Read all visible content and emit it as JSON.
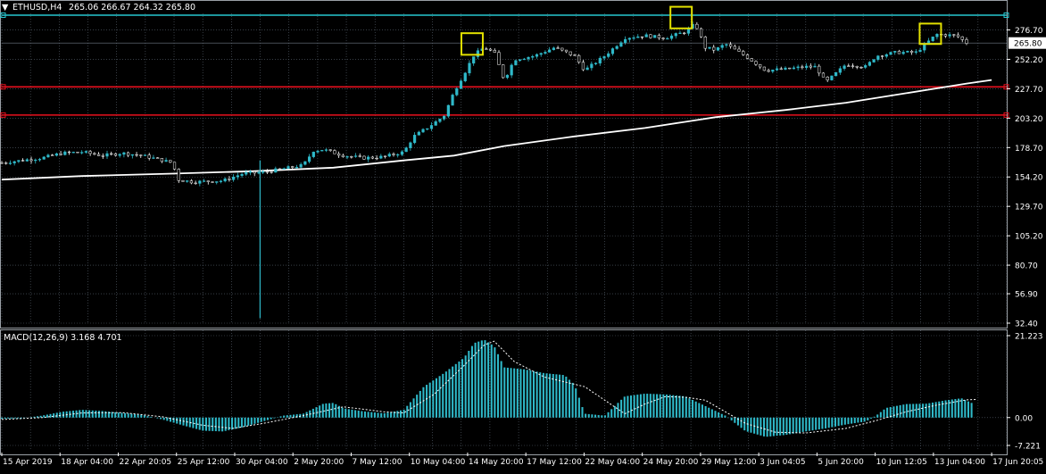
{
  "header": {
    "symbol": "ETHUSD,H4",
    "ohlc": "265.06 266.67 264.32 265.80"
  },
  "macd_label": "MACD(12,26,9) 3.168 4.701",
  "colors": {
    "background": "#000000",
    "grid": "#5a6470",
    "axis": "#ffffff",
    "bull": "#2fb9c9",
    "bear": "#ffffff",
    "ma": "#ffffff",
    "resistance": "#e8101e",
    "top_line": "#27c7d0",
    "highlight": "#e2e000",
    "macd_hist": "#2fb9c9",
    "macd_signal": "#ffffff"
  },
  "chart_data": [
    {
      "type": "candlestick",
      "title": "ETHUSD,H4",
      "y_ticks": [
        "276.70",
        "252.20",
        "227.70",
        "203.20",
        "178.70",
        "154.20",
        "129.70",
        "105.20",
        "80.70",
        "56.90",
        "32.40"
      ],
      "ylim": [
        32.4,
        289.0
      ],
      "current_price": "265.80",
      "x_ticks": [
        "15 Apr 2019",
        "18 Apr 04:00",
        "22 Apr 20:05",
        "25 Apr 12:00",
        "30 Apr 04:00",
        "2 May 20:00",
        "7 May 12:00",
        "10 May 04:00",
        "14 May 20:00",
        "17 May 12:00",
        "22 May 04:00",
        "24 May 20:00",
        "29 May 12:00",
        "3 Jun 04:05",
        "5 Jun 20:00",
        "10 Jun 12:05",
        "13 Jun 04:00",
        "17 Jun 20:05"
      ],
      "close_path": [
        [
          0,
          166
        ],
        [
          0.02,
          168
        ],
        [
          0.04,
          170
        ],
        [
          0.06,
          174
        ],
        [
          0.08,
          175
        ],
        [
          0.1,
          172
        ],
        [
          0.12,
          174
        ],
        [
          0.14,
          172
        ],
        [
          0.16,
          168
        ],
        [
          0.17,
          166
        ],
        [
          0.175,
          152
        ],
        [
          0.19,
          150
        ],
        [
          0.22,
          151
        ],
        [
          0.24,
          157
        ],
        [
          0.26,
          158
        ],
        [
          0.28,
          161
        ],
        [
          0.3,
          164
        ],
        [
          0.31,
          176
        ],
        [
          0.32,
          177
        ],
        [
          0.34,
          172
        ],
        [
          0.36,
          170
        ],
        [
          0.38,
          171
        ],
        [
          0.4,
          175
        ],
        [
          0.41,
          188
        ],
        [
          0.425,
          196
        ],
        [
          0.44,
          205
        ],
        [
          0.45,
          225
        ],
        [
          0.46,
          240
        ],
        [
          0.47,
          256
        ],
        [
          0.48,
          262
        ],
        [
          0.49,
          258
        ],
        [
          0.5,
          235
        ],
        [
          0.51,
          252
        ],
        [
          0.53,
          255
        ],
        [
          0.55,
          262
        ],
        [
          0.57,
          255
        ],
        [
          0.58,
          243
        ],
        [
          0.6,
          255
        ],
        [
          0.62,
          270
        ],
        [
          0.64,
          272
        ],
        [
          0.66,
          270
        ],
        [
          0.68,
          275
        ],
        [
          0.69,
          282
        ],
        [
          0.7,
          262
        ],
        [
          0.71,
          260
        ],
        [
          0.72,
          265
        ],
        [
          0.74,
          255
        ],
        [
          0.76,
          243
        ],
        [
          0.78,
          244
        ],
        [
          0.8,
          246
        ],
        [
          0.81,
          246
        ],
        [
          0.82,
          233
        ],
        [
          0.84,
          248
        ],
        [
          0.86,
          246
        ],
        [
          0.87,
          255
        ],
        [
          0.89,
          258
        ],
        [
          0.91,
          258
        ],
        [
          0.93,
          273
        ],
        [
          0.95,
          272
        ],
        [
          0.96,
          266
        ]
      ],
      "ma_path": [
        [
          0,
          152
        ],
        [
          0.08,
          155
        ],
        [
          0.17,
          157
        ],
        [
          0.25,
          159
        ],
        [
          0.33,
          162
        ],
        [
          0.4,
          168
        ],
        [
          0.45,
          172
        ],
        [
          0.5,
          180
        ],
        [
          0.57,
          188
        ],
        [
          0.64,
          195
        ],
        [
          0.71,
          204
        ],
        [
          0.78,
          210
        ],
        [
          0.84,
          216
        ],
        [
          0.9,
          224
        ],
        [
          0.96,
          232
        ],
        [
          0.985,
          235
        ]
      ],
      "horizontal_lines": [
        {
          "role": "top",
          "value": 289.0
        },
        {
          "role": "resistance-1",
          "value": 229.3
        },
        {
          "role": "resistance-2",
          "value": 205.8
        },
        {
          "role": "current",
          "value": 265.8
        }
      ],
      "spike": {
        "x": 0.257,
        "low": 36.5,
        "high": 168
      },
      "highlights": [
        {
          "x": 0.468,
          "low": 256,
          "high": 274
        },
        {
          "x": 0.676,
          "low": 278,
          "high": 296
        },
        {
          "x": 0.924,
          "low": 265,
          "high": 282
        }
      ]
    },
    {
      "type": "bar",
      "title": "MACD(12,26,9) 3.168 4.701",
      "y_ticks": [
        "21.223",
        "0.00",
        "-7.221"
      ],
      "ylim": [
        -7.221,
        21.223
      ],
      "histogram_path": [
        [
          0,
          -0.3
        ],
        [
          0.02,
          -0.2
        ],
        [
          0.04,
          0.5
        ],
        [
          0.06,
          1.5
        ],
        [
          0.08,
          2.0
        ],
        [
          0.1,
          1.7
        ],
        [
          0.12,
          1.2
        ],
        [
          0.14,
          0.7
        ],
        [
          0.16,
          -0.5
        ],
        [
          0.18,
          -2.0
        ],
        [
          0.2,
          -3.4
        ],
        [
          0.22,
          -3.6
        ],
        [
          0.24,
          -2.5
        ],
        [
          0.26,
          -1.0
        ],
        [
          0.28,
          0.5
        ],
        [
          0.3,
          1.0
        ],
        [
          0.32,
          3.6
        ],
        [
          0.33,
          3.8
        ],
        [
          0.34,
          2.4
        ],
        [
          0.36,
          1.6
        ],
        [
          0.38,
          1.1
        ],
        [
          0.4,
          2.0
        ],
        [
          0.42,
          8.0
        ],
        [
          0.44,
          11.5
        ],
        [
          0.46,
          15.5
        ],
        [
          0.47,
          19.3
        ],
        [
          0.48,
          20.2
        ],
        [
          0.49,
          18.5
        ],
        [
          0.5,
          13.0
        ],
        [
          0.52,
          12.5
        ],
        [
          0.54,
          11.5
        ],
        [
          0.56,
          11.0
        ],
        [
          0.57,
          8.5
        ],
        [
          0.58,
          1.0
        ],
        [
          0.6,
          0.5
        ],
        [
          0.62,
          5.5
        ],
        [
          0.64,
          6.2
        ],
        [
          0.66,
          6.0
        ],
        [
          0.68,
          5.5
        ],
        [
          0.7,
          3.0
        ],
        [
          0.72,
          0.5
        ],
        [
          0.74,
          -3.5
        ],
        [
          0.76,
          -5.0
        ],
        [
          0.78,
          -4.5
        ],
        [
          0.8,
          -3.6
        ],
        [
          0.82,
          -2.8
        ],
        [
          0.84,
          -1.8
        ],
        [
          0.86,
          -1.0
        ],
        [
          0.87,
          0.5
        ],
        [
          0.88,
          2.5
        ],
        [
          0.9,
          3.5
        ],
        [
          0.92,
          3.6
        ],
        [
          0.94,
          4.5
        ],
        [
          0.955,
          5.0
        ],
        [
          0.965,
          3.8
        ]
      ],
      "signal_path": [
        [
          0,
          -0.5
        ],
        [
          0.04,
          0.0
        ],
        [
          0.08,
          1.2
        ],
        [
          0.12,
          1.3
        ],
        [
          0.16,
          0.2
        ],
        [
          0.2,
          -2.0
        ],
        [
          0.23,
          -2.8
        ],
        [
          0.26,
          -1.5
        ],
        [
          0.3,
          0.5
        ],
        [
          0.34,
          2.8
        ],
        [
          0.38,
          1.5
        ],
        [
          0.4,
          1.2
        ],
        [
          0.43,
          6.0
        ],
        [
          0.46,
          13.5
        ],
        [
          0.48,
          18.8
        ],
        [
          0.49,
          19.8
        ],
        [
          0.51,
          14.5
        ],
        [
          0.54,
          10.5
        ],
        [
          0.58,
          8.0
        ],
        [
          0.6,
          4.5
        ],
        [
          0.62,
          1.0
        ],
        [
          0.64,
          3.5
        ],
        [
          0.66,
          5.4
        ],
        [
          0.68,
          5.3
        ],
        [
          0.7,
          4.5
        ],
        [
          0.72,
          1.5
        ],
        [
          0.74,
          -1.5
        ],
        [
          0.77,
          -3.8
        ],
        [
          0.8,
          -4.0
        ],
        [
          0.84,
          -2.8
        ],
        [
          0.87,
          -0.8
        ],
        [
          0.9,
          1.5
        ],
        [
          0.93,
          3.2
        ],
        [
          0.96,
          4.6
        ],
        [
          0.97,
          4.7
        ]
      ]
    }
  ]
}
